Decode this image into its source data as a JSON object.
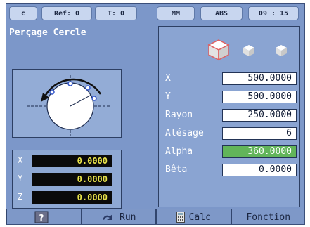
{
  "status_bar": {
    "mode": "c",
    "ref_label": "Ref:",
    "ref_value": "0",
    "tool_label": "T:",
    "tool_value": "0",
    "units": "MM",
    "coord_mode": "ABS",
    "time": "09 : 15"
  },
  "left_panel": {
    "title": "Perçage Cercle",
    "position_readout": [
      {
        "axis": "X",
        "value": "0.0000"
      },
      {
        "axis": "Y",
        "value": "0.0000"
      },
      {
        "axis": "Z",
        "value": "0.0000"
      }
    ]
  },
  "parameters": [
    {
      "label": "X",
      "value": "500.0000",
      "active": false
    },
    {
      "label": "Y",
      "value": "500.0000",
      "active": false
    },
    {
      "label": "Rayon",
      "value": "250.0000",
      "active": false
    },
    {
      "label": "Alésage",
      "value": "6",
      "active": false
    },
    {
      "label": "Alpha",
      "value": "360.0000",
      "active": true
    },
    {
      "label": "Bêta",
      "value": "0.0000",
      "active": false
    }
  ],
  "softkeys": [
    {
      "label": "",
      "icon": "help-icon"
    },
    {
      "label": "Run",
      "icon": "run-icon"
    },
    {
      "label": "Calc",
      "icon": "calculator-icon"
    },
    {
      "label": "Fonction",
      "icon": ""
    }
  ],
  "colors": {
    "background": "#7c97c9",
    "readout_bg": "#0a0a0a",
    "readout_text": "#e9e44a",
    "active_field": "#62b55a"
  }
}
